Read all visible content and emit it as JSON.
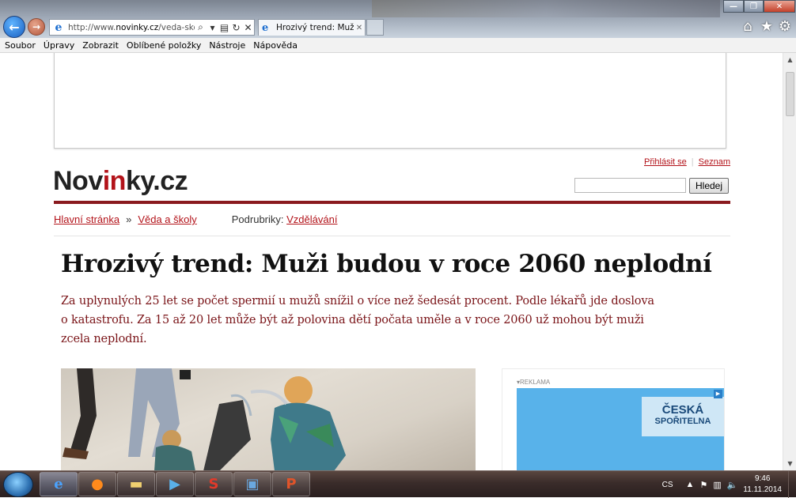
{
  "browser": {
    "address_prefix": "http://www.",
    "address_domain": "novinky.cz",
    "address_suffix": "/veda-sko",
    "tab_title": "Hrozivý trend: Muži ...",
    "icons": [
      "back-icon",
      "forward-icon",
      "ie-icon",
      "search-icon",
      "dropdown-icon",
      "compat-icon",
      "refresh-icon",
      "close-icon",
      "home-icon",
      "favorites-star-icon",
      "settings-gear-icon"
    ]
  },
  "menu": [
    "Soubor",
    "Úpravy",
    "Zobrazit",
    "Oblíbené položky",
    "Nástroje",
    "Nápověda"
  ],
  "site": {
    "links": {
      "login": "Přihlásit se",
      "seznam": "Seznam"
    },
    "logo_a": "Nov",
    "logo_b": "in",
    "logo_c": "ky.cz",
    "search_button": "Hledej",
    "breadcrumb": {
      "home": "Hlavní stránka",
      "arrow": "»",
      "section": "Věda a školy",
      "sub_label": "Podrubriky:",
      "sub_link": "Vzdělávání"
    },
    "colors": {
      "brand_red": "#b3131a",
      "bar": "#8a1a1e",
      "ad_blue": "#58b2ea"
    }
  },
  "article": {
    "headline": "Hrozivý trend: Muži budou v roce 2060 neplodní",
    "perex": "Za uplynulých 25 let se počet spermií u mužů snížil o více než šedesát procent. Podle lékařů jde doslova o katastrofu. Za 15 až 20 let může být až polovina dětí počata uměle a v roce 2060 už mohou být muži zcela neplodní."
  },
  "ad": {
    "label": "▾REKLAMA",
    "brand_line1": "ČESKÁ",
    "brand_line2": "SPOŘITELNA"
  },
  "taskbar": {
    "lang": "CS",
    "time": "9:46",
    "date": "11.11.2014"
  }
}
